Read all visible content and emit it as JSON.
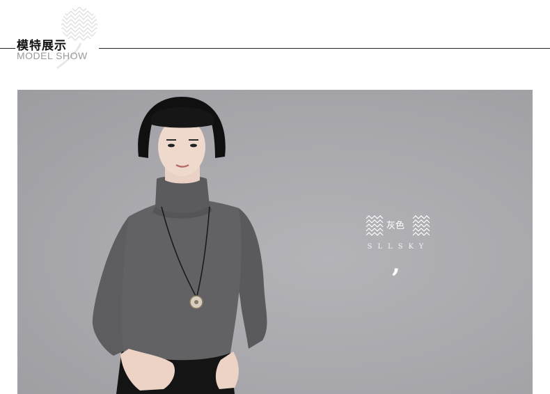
{
  "header": {
    "title_cn": "模特展示",
    "title_en": "MODEL SHOW"
  },
  "photo": {
    "color_label": "灰色",
    "brand": "SLLSKY",
    "mark": ","
  },
  "icons": {
    "header_decoration": "zigzag-badge-icon",
    "tag_left": "zigzag-icon",
    "tag_right": "zigzag-icon"
  },
  "colors": {
    "background": "#ffffff",
    "photo_bg": "#a9a9ae",
    "sweater": "#5e5e60",
    "hair": "#111111",
    "rule": "#222222",
    "subtitle": "#999999"
  }
}
